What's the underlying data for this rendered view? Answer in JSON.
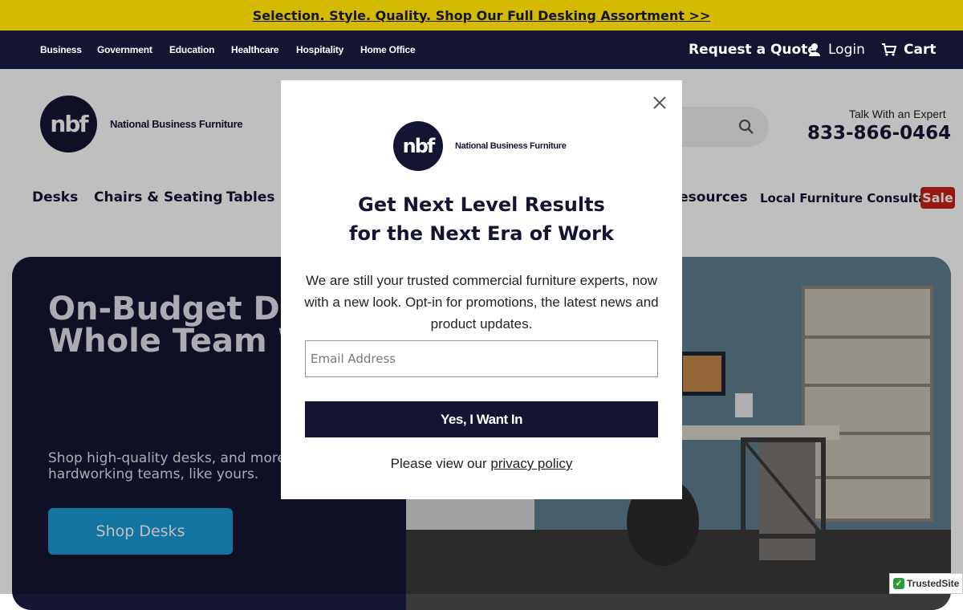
{
  "promo": {
    "text": "Selection. Style. Quality. Shop Our Full Desking Assortment >>"
  },
  "topnav": {
    "segments": [
      "Business",
      "Government",
      "Education",
      "Healthcare",
      "Hospitality",
      "Home Office"
    ],
    "request_quote": "Request a Quote",
    "login": "Login",
    "cart": "Cart"
  },
  "header": {
    "logo_mark": "nbf",
    "logo_text": "National Business Furniture",
    "expert_label": "Talk With an Expert",
    "phone": "833-866-0464"
  },
  "mainnav": {
    "items": [
      "Desks",
      "Chairs & Seating",
      "Tables",
      "Resources",
      "Local Furniture Consultant"
    ],
    "sale": "Sale"
  },
  "hero": {
    "title": "On-Budget Desks Your Whole Team Will Love",
    "subtitle": "Shop high-quality desks, and more, by NBF. For hardworking teams, like yours.",
    "cta": "Shop Desks"
  },
  "modal": {
    "logo_mark": "nbf",
    "logo_text": "National Business Furniture",
    "title_line1": "Get Next Level Results",
    "title_line2": "for the Next Era of Work",
    "body": "We are still your trusted commercial furniture experts, now with a new look. Opt-in for promotions, the latest news and product updates.",
    "email_placeholder": "Email Address",
    "submit": "Yes, I Want In",
    "policy_prefix": "Please view our ",
    "policy_link": "privacy policy"
  },
  "badge": {
    "trusted": "TrustedSite"
  },
  "colors": {
    "navy": "#141433",
    "promo": "#d4ba00",
    "accent_blue": "#1a9bd7",
    "sale_red": "#c8201a"
  }
}
